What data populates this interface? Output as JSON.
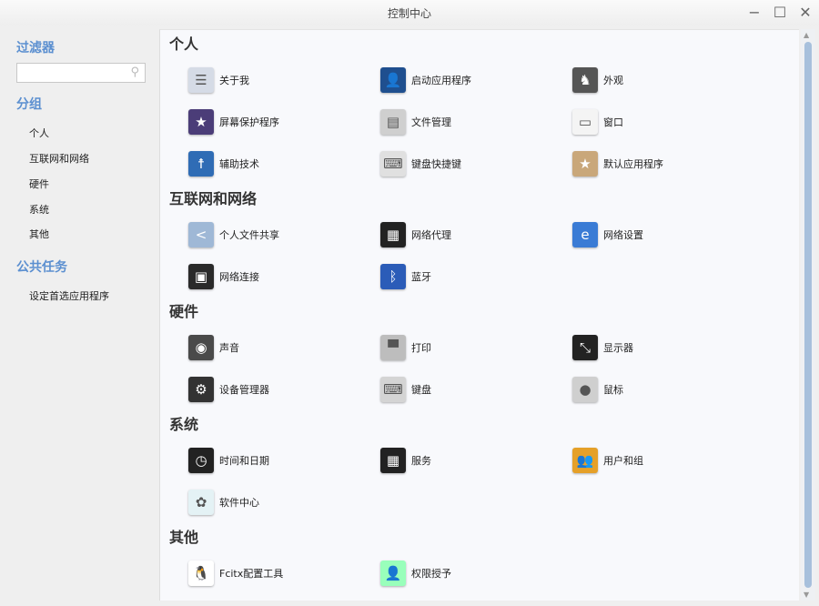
{
  "window": {
    "title": "控制中心",
    "minimize": "−",
    "maximize": "☐",
    "close": "✕"
  },
  "sidebar": {
    "filter_heading": "过滤器",
    "search_placeholder": "",
    "search_icon": "⚲",
    "group_heading": "分组",
    "groups": [
      "个人",
      "互联网和网络",
      "硬件",
      "系统",
      "其他"
    ],
    "tasks_heading": "公共任务",
    "tasks": [
      "设定首选应用程序"
    ]
  },
  "sections": [
    {
      "title": "个人",
      "rows": [
        [
          {
            "label": "关于我",
            "icon": "id-card-icon",
            "glyph": "☰",
            "color": "#d5dbe6"
          },
          {
            "label": "启动应用程序",
            "icon": "user-silhouette-icon",
            "glyph": "👤",
            "color": "#1f4f8f"
          },
          {
            "label": "外观",
            "icon": "suit-icon",
            "glyph": "♞",
            "color": "#555"
          }
        ],
        [
          {
            "label": "屏幕保护程序",
            "icon": "screensaver-icon",
            "glyph": "★",
            "color": "#4b3d78"
          },
          {
            "label": "文件管理",
            "icon": "file-cabinet-icon",
            "glyph": "▤",
            "color": "#cfcfcf"
          },
          {
            "label": "窗口",
            "icon": "window-icon",
            "glyph": "▭",
            "color": "#f4f4f4"
          }
        ],
        [
          {
            "label": "辅助技术",
            "icon": "accessibility-icon",
            "glyph": "☨",
            "color": "#2f6cb5"
          },
          {
            "label": "键盘快捷键",
            "icon": "keyboard-shortcut-icon",
            "glyph": "⌨",
            "color": "#e0e0e0"
          },
          {
            "label": "默认应用程序",
            "icon": "default-apps-box-icon",
            "glyph": "★",
            "color": "#c9a77a"
          }
        ]
      ]
    },
    {
      "title": "互联网和网络",
      "rows": [
        [
          {
            "label": "个人文件共享",
            "icon": "share-folder-icon",
            "glyph": "<",
            "color": "#9fb8d6"
          },
          {
            "label": "网络代理",
            "icon": "proxy-server-icon",
            "glyph": "▦",
            "color": "#222"
          },
          {
            "label": "网络设置",
            "icon": "network-settings-icon",
            "glyph": "e",
            "color": "#3a7bd5"
          }
        ],
        [
          {
            "label": "网络连接",
            "icon": "network-connection-icon",
            "glyph": "▣",
            "color": "#2a2a2a"
          },
          {
            "label": "蓝牙",
            "icon": "bluetooth-icon",
            "glyph": "ᛒ",
            "color": "#2b5cb8"
          }
        ]
      ]
    },
    {
      "title": "硬件",
      "rows": [
        [
          {
            "label": "声音",
            "icon": "speaker-icon",
            "glyph": "◉",
            "color": "#4a4a4a"
          },
          {
            "label": "打印",
            "icon": "printer-icon",
            "glyph": "▀",
            "color": "#bdbdbd"
          },
          {
            "label": "显示器",
            "icon": "display-icon",
            "glyph": "⤡",
            "color": "#222"
          }
        ],
        [
          {
            "label": "设备管理器",
            "icon": "device-manager-icon",
            "glyph": "⚙",
            "color": "#333"
          },
          {
            "label": "键盘",
            "icon": "keyboard-icon",
            "glyph": "⌨",
            "color": "#d4d4d4"
          },
          {
            "label": "鼠标",
            "icon": "mouse-icon",
            "glyph": "●",
            "color": "#cfcfcf"
          }
        ]
      ]
    },
    {
      "title": "系统",
      "rows": [
        [
          {
            "label": "时间和日期",
            "icon": "clock-icon",
            "glyph": "◷",
            "color": "#222"
          },
          {
            "label": "服务",
            "icon": "services-server-icon",
            "glyph": "▦",
            "color": "#222"
          },
          {
            "label": "用户和组",
            "icon": "users-groups-icon",
            "glyph": "👥",
            "color": "#e5a028"
          }
        ],
        [
          {
            "label": "软件中心",
            "icon": "software-center-icon",
            "glyph": "✿",
            "color": "#e4f2f5"
          }
        ]
      ]
    },
    {
      "title": "其他",
      "rows": [
        [
          {
            "label": "Fcitx配置工具",
            "icon": "penguin-icon",
            "glyph": "🐧",
            "color": "#ffffff"
          },
          {
            "label": "权限授予",
            "icon": "permission-user-icon",
            "glyph": "👤",
            "color": "#9fb"
          }
        ]
      ]
    }
  ]
}
